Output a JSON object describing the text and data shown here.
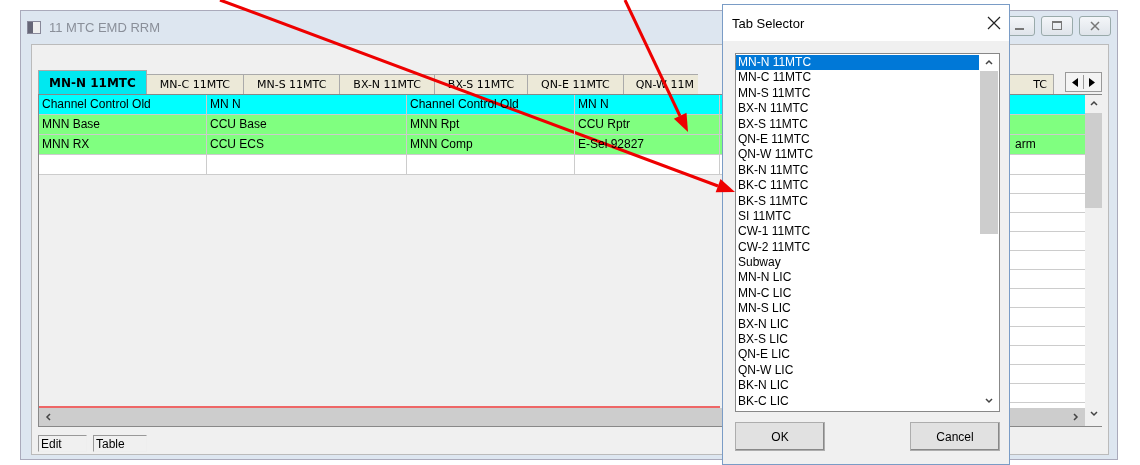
{
  "window": {
    "title": "11 MTC EMD RRM"
  },
  "tabs": [
    {
      "label": "MN-N 11MTC",
      "selected": true,
      "kind": "full"
    },
    {
      "label": "MN-C 11MTC",
      "selected": false,
      "kind": "full"
    },
    {
      "label": "MN-S 11MTC",
      "selected": false,
      "kind": "full"
    },
    {
      "label": "BX-N 11MTC",
      "selected": false,
      "kind": "full"
    },
    {
      "label": "BX-S 11MTC",
      "selected": false,
      "kind": "full"
    },
    {
      "label": "QN-E 11MTC",
      "selected": false,
      "kind": "full"
    },
    {
      "label": "QN-W 11M",
      "selected": false,
      "kind": "cut"
    },
    {
      "label": "TC",
      "selected": false,
      "kind": "tail"
    }
  ],
  "table": {
    "rows": [
      {
        "color": "#00ffff",
        "cells": [
          "Channel Control Old",
          "MN N",
          "Channel Control Old",
          "MN N"
        ]
      },
      {
        "color": "#80ff80",
        "cells": [
          "MNN Base",
          "CCU Base",
          "MNN Rpt",
          "CCU Rptr"
        ]
      },
      {
        "color": "#80ff80",
        "cells": [
          "MNN RX",
          "CCU ECS",
          "MNN Comp",
          "E-Sel 92827"
        ],
        "right_cell": "arm"
      },
      {
        "color": "#ffffff"
      }
    ]
  },
  "status_bar": [
    "Edit",
    "Table"
  ],
  "dialog": {
    "title": "Tab Selector",
    "items": [
      {
        "label": "MN-N 11MTC",
        "selected": true
      },
      {
        "label": "MN-C 11MTC",
        "selected": false
      },
      {
        "label": "MN-S 11MTC",
        "selected": false
      },
      {
        "label": "BX-N 11MTC",
        "selected": false
      },
      {
        "label": "BX-S 11MTC",
        "selected": false
      },
      {
        "label": "QN-E 11MTC",
        "selected": false
      },
      {
        "label": "QN-W 11MTC",
        "selected": false
      },
      {
        "label": "BK-N 11MTC",
        "selected": false
      },
      {
        "label": "BK-C 11MTC",
        "selected": false
      },
      {
        "label": "BK-S 11MTC",
        "selected": false
      },
      {
        "label": "SI 11MTC",
        "selected": false
      },
      {
        "label": "CW-1 11MTC",
        "selected": false
      },
      {
        "label": "CW-2 11MTC",
        "selected": false
      },
      {
        "label": "Subway",
        "selected": false
      },
      {
        "label": "MN-N LIC",
        "selected": false
      },
      {
        "label": "MN-C LIC",
        "selected": false
      },
      {
        "label": "MN-S LIC",
        "selected": false
      },
      {
        "label": "BX-N LIC",
        "selected": false
      },
      {
        "label": "BX-S LIC",
        "selected": false
      },
      {
        "label": "QN-E LIC",
        "selected": false
      },
      {
        "label": "QN-W LIC",
        "selected": false
      },
      {
        "label": "BK-N LIC",
        "selected": false
      },
      {
        "label": "BK-C LIC",
        "selected": false
      }
    ],
    "buttons": [
      "OK",
      "Cancel"
    ]
  }
}
